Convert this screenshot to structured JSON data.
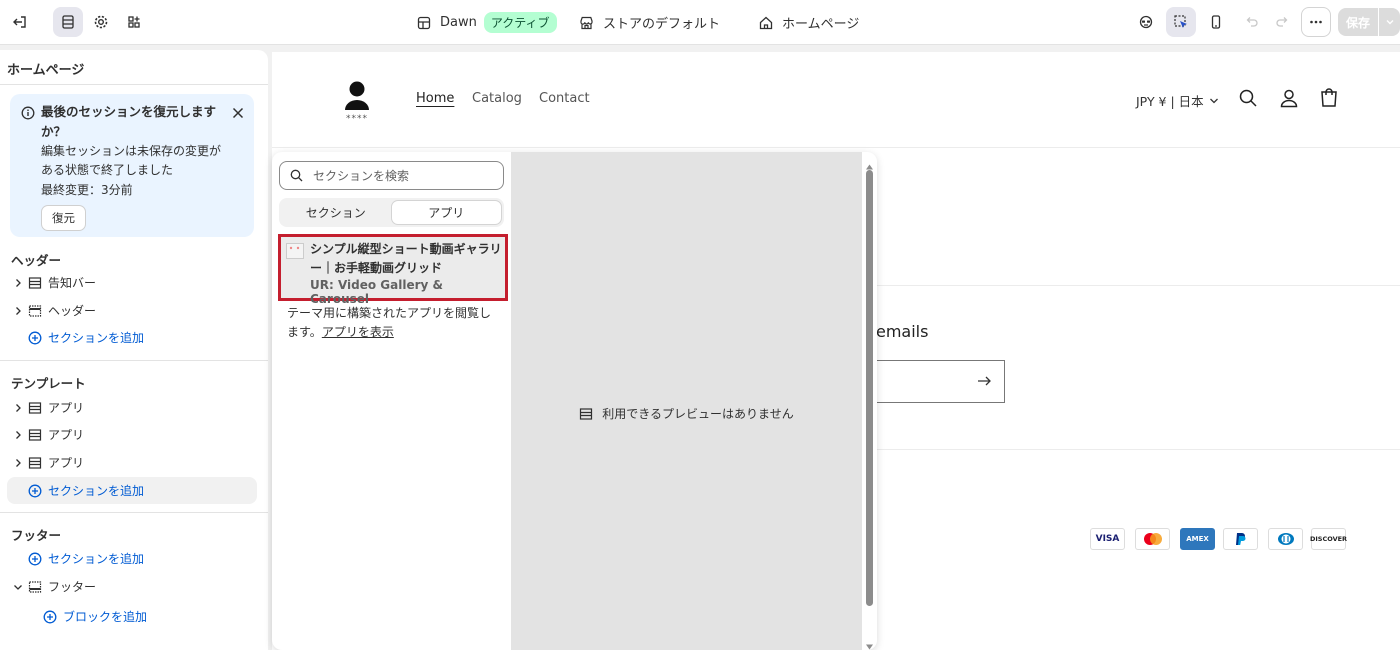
{
  "topbar": {
    "theme_name": "Dawn",
    "theme_badge": "アクティブ",
    "store_default": "ストアのデフォルト",
    "page_selector": "ホームページ",
    "save_label": "保存"
  },
  "sidebar": {
    "title": "ホームページ",
    "banner": {
      "title": "最後のセッションを復元しますか？",
      "body": "編集セッションは未保存の変更がある状態で終了しました",
      "meta": "最終変更：3分前",
      "restore": "復元"
    },
    "header_group": {
      "label": "ヘッダー",
      "items": [
        "告知バー",
        "ヘッダー"
      ],
      "add": "セクションを追加"
    },
    "template_group": {
      "label": "テンプレート",
      "items": [
        "アプリ",
        "アプリ",
        "アプリ"
      ],
      "add": "セクションを追加"
    },
    "footer_group": {
      "label": "フッター",
      "add": "セクションを追加",
      "items": [
        "フッター"
      ],
      "add_block": "ブロックを追加"
    }
  },
  "picker": {
    "search_placeholder": "セクションを検索",
    "tabs": [
      "セクション",
      "アプリ"
    ],
    "selected_tab": "アプリ",
    "app": {
      "title": "シンプル縦型ショート動画ギャラリー｜お手軽動画グリッド",
      "subtitle": "UR: Video Gallery & Carousel"
    },
    "browse_text": "テーマ用に構築されたアプリを閲覧します。",
    "browse_link": "アプリを表示",
    "no_preview": "利用できるプレビューはありません"
  },
  "store": {
    "logo_text": "****",
    "nav": [
      "Home",
      "Catalog",
      "Contact"
    ],
    "currency": "JPY ¥ | 日本",
    "newsletter_fragment": "emails",
    "payments": [
      "VISA",
      "Mastercard",
      "AMEX",
      "PayPal",
      "Diners",
      "DISCOVER"
    ]
  },
  "colors": {
    "accent_blue": "#005bd3",
    "highlight_red": "#c41e2e",
    "badge_green": "#b4fed2"
  }
}
